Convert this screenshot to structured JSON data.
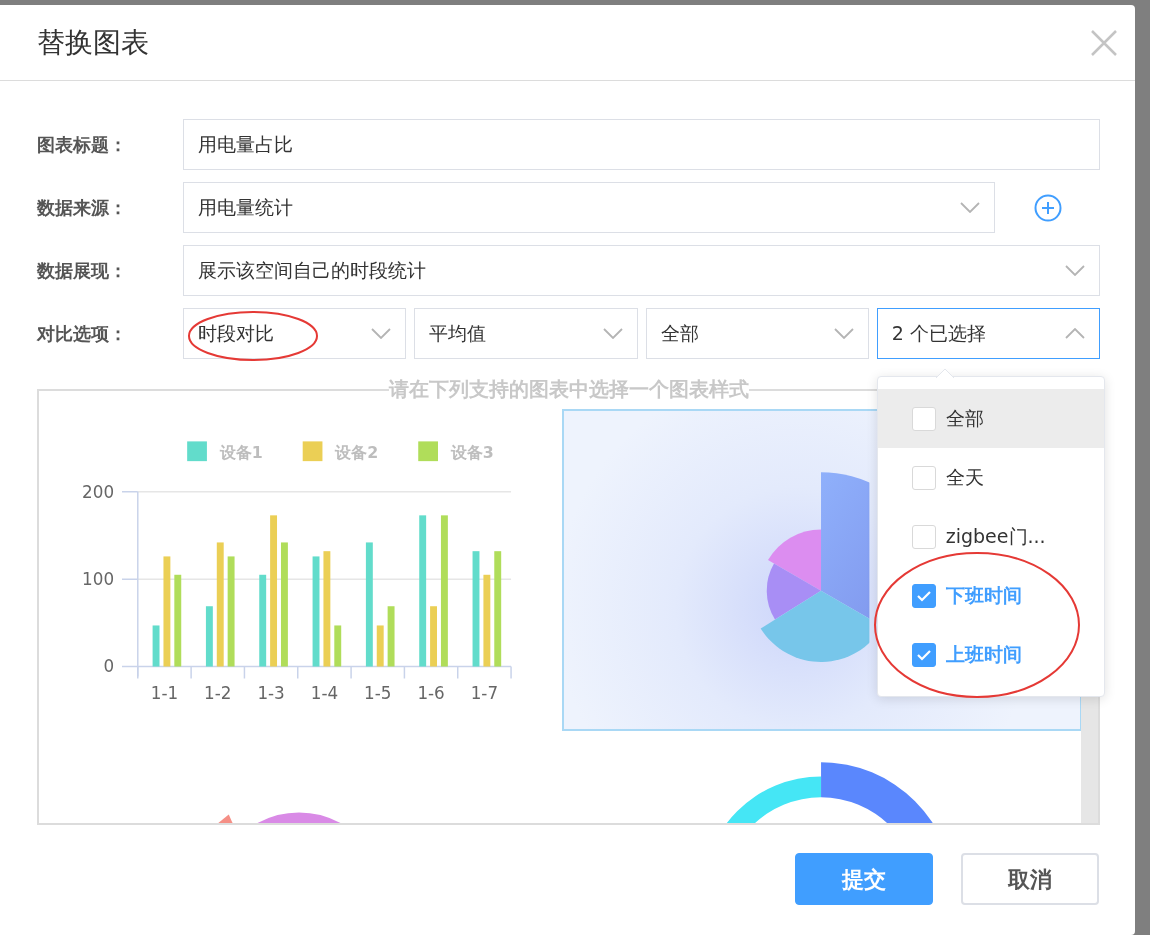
{
  "dialog": {
    "title": "替换图表"
  },
  "form": {
    "fields": [
      {
        "label": "图表标题：",
        "kind": "text",
        "value": "用电量占比",
        "add_button": false
      },
      {
        "label": "数据来源：",
        "kind": "select",
        "value": "用电量统计",
        "add_button": true
      },
      {
        "label": "数据展现：",
        "kind": "select",
        "value": "展示该空间自己的时段统计",
        "add_button": false
      }
    ],
    "compare": {
      "label": "对比选项：",
      "selects": [
        {
          "value": "时段对比",
          "open": false,
          "circled": true
        },
        {
          "value": "平均值",
          "open": false,
          "circled": false
        },
        {
          "value": "全部",
          "open": false,
          "circled": false
        },
        {
          "value": "2 个已选择",
          "open": true,
          "circled": false
        }
      ]
    }
  },
  "dropdown": {
    "options": [
      {
        "label": "全部",
        "checked": false,
        "hovered": true,
        "circled": false
      },
      {
        "label": "全天",
        "checked": false,
        "hovered": false,
        "circled": false
      },
      {
        "label": "zigbee门...",
        "checked": false,
        "hovered": false,
        "circled": false
      },
      {
        "label": "下班时间",
        "checked": true,
        "hovered": false,
        "circled": true
      },
      {
        "label": "上班时间",
        "checked": true,
        "hovered": false,
        "circled": true
      }
    ]
  },
  "gallery": {
    "caption": "请在下列支持的图表中选择一个图表样式",
    "charts": [
      {
        "kind": "bar",
        "selected": false,
        "chart_data": {
          "type": "bar",
          "legend": "top",
          "categories": [
            "1-1",
            "1-2",
            "1-3",
            "1-4",
            "1-5",
            "1-6",
            "1-7"
          ],
          "ylim": [
            0,
            200
          ],
          "yticks": [
            0,
            100,
            200
          ],
          "series": [
            {
              "name": "设备1",
              "color": "#62dccb",
              "values": [
                47,
                69,
                105,
                126,
                142,
                173,
                132
              ]
            },
            {
              "name": "设备2",
              "color": "#ebcf55",
              "values": [
                126,
                142,
                173,
                132,
                47,
                69,
                105
              ]
            },
            {
              "name": "设备3",
              "color": "#b0dd5a",
              "values": [
                105,
                126,
                142,
                47,
                69,
                173,
                132
              ]
            }
          ]
        }
      },
      {
        "kind": "rose",
        "selected": true
      },
      {
        "kind": "pie",
        "selected": false
      },
      {
        "kind": "donut",
        "selected": false
      }
    ]
  },
  "buttons": [
    {
      "label": "提交",
      "kind": "primary"
    },
    {
      "label": "取消",
      "kind": "default"
    }
  ]
}
